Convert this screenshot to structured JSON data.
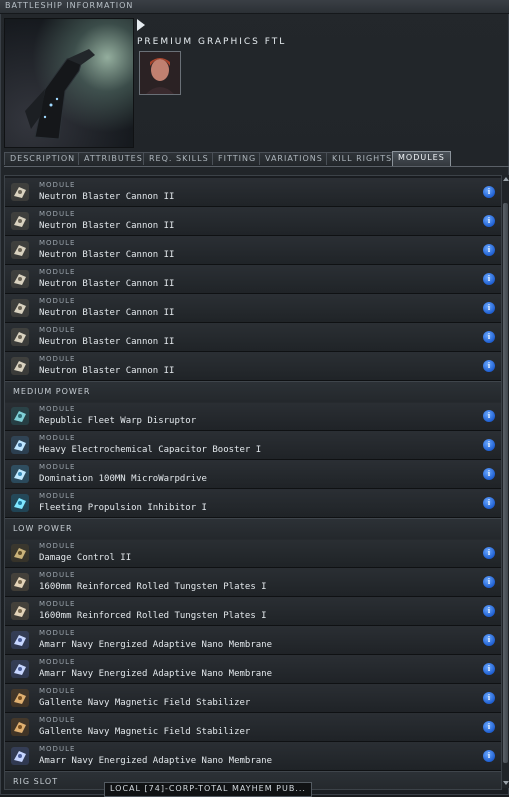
{
  "window": {
    "title": "BATTLESHIP INFORMATION"
  },
  "header": {
    "ship_name": "PREMIUM GRAPHICS FTL"
  },
  "tabs": [
    {
      "label": "DESCRIPTION"
    },
    {
      "label": "ATTRIBUTES"
    },
    {
      "label": "REQ. SKILLS"
    },
    {
      "label": "FITTING"
    },
    {
      "label": "VARIATIONS"
    },
    {
      "label": "KILL RIGHTS"
    },
    {
      "label": "MODULES",
      "active": true
    }
  ],
  "list": {
    "kind_label": "MODULE",
    "info_glyph": "i",
    "high": [
      {
        "name": "Neutron Blaster Cannon II",
        "icon": "blaster-icon"
      },
      {
        "name": "Neutron Blaster Cannon II",
        "icon": "blaster-icon"
      },
      {
        "name": "Neutron Blaster Cannon II",
        "icon": "blaster-icon"
      },
      {
        "name": "Neutron Blaster Cannon II",
        "icon": "blaster-icon"
      },
      {
        "name": "Neutron Blaster Cannon II",
        "icon": "blaster-icon"
      },
      {
        "name": "Neutron Blaster Cannon II",
        "icon": "blaster-icon"
      },
      {
        "name": "Neutron Blaster Cannon II",
        "icon": "blaster-icon"
      }
    ],
    "medium_label": "MEDIUM POWER",
    "medium": [
      {
        "name": "Republic Fleet Warp Disruptor",
        "icon": "warp-disruptor-icon"
      },
      {
        "name": "Heavy Electrochemical Capacitor Booster I",
        "icon": "capacitor-booster-icon"
      },
      {
        "name": "Domination 100MN MicroWarpdrive",
        "icon": "microwarpdrive-icon"
      },
      {
        "name": "Fleeting Propulsion Inhibitor I",
        "icon": "propulsion-inhibitor-icon"
      }
    ],
    "low_label": "LOW POWER",
    "low": [
      {
        "name": "Damage Control II",
        "icon": "damage-control-icon"
      },
      {
        "name": "1600mm Reinforced Rolled Tungsten Plates I",
        "icon": "armor-plate-icon"
      },
      {
        "name": "1600mm Reinforced Rolled Tungsten Plates I",
        "icon": "armor-plate-icon"
      },
      {
        "name": "Amarr Navy Energized Adaptive Nano Membrane",
        "icon": "nano-membrane-icon"
      },
      {
        "name": "Amarr Navy Energized Adaptive Nano Membrane",
        "icon": "nano-membrane-icon"
      },
      {
        "name": "Gallente Navy Magnetic Field Stabilizer",
        "icon": "field-stabilizer-icon"
      },
      {
        "name": "Gallente Navy Magnetic Field Stabilizer",
        "icon": "field-stabilizer-icon"
      },
      {
        "name": "Amarr Navy Energized Adaptive Nano Membrane",
        "icon": "nano-membrane-icon"
      }
    ],
    "rig_label": "RIG SLOT"
  },
  "chat": {
    "label": "LOCAL [74]-CORP-TOTAL MAYHEM PUB..."
  },
  "colors": {
    "info": "#2f74e6",
    "accent": "#8b939a"
  }
}
